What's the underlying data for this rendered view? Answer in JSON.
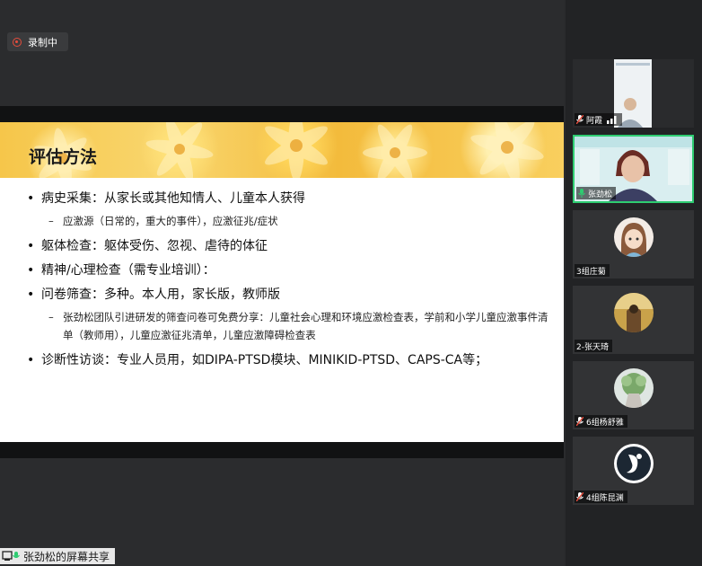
{
  "recording": {
    "label": "录制中"
  },
  "slide": {
    "title": "评估方法",
    "bullets": [
      {
        "text": "病史采集：从家长或其他知情人、儿童本人获得"
      },
      {
        "sub": "应激源（日常的，重大的事件），应激征兆/症状"
      },
      {
        "text": "躯体检查：躯体受伤、忽视、虐待的体征"
      },
      {
        "text": "精神/心理检查（需专业培训）："
      },
      {
        "text": "问卷筛查：多种。本人用，家长版，教师版"
      },
      {
        "sub": "张劲松团队引进研发的筛查问卷可免费分享：儿童社会心理和环境应激检查表，学前和小学儿童应激事件清单（教师用），儿童应激征兆清单，儿童应激障碍检查表"
      },
      {
        "text": "诊断性访谈：专业人员用，如DIPA-PTSD模块、MINIKID-PTSD、CAPS-CA等；"
      }
    ],
    "dash": "–"
  },
  "share": {
    "label": "张劲松的屏幕共享"
  },
  "participants": [
    {
      "name": "阿霞",
      "muted": true,
      "speaking": false
    },
    {
      "name": "张劲松",
      "muted": false,
      "speaking": true
    },
    {
      "name": "3组庄菊",
      "muted": false,
      "speaking": false
    },
    {
      "name": "2-张天琦",
      "muted": false,
      "speaking": false
    },
    {
      "name": "6组杨舒雅",
      "muted": true,
      "speaking": false
    },
    {
      "name": "4组陈昆渊",
      "muted": true,
      "speaking": false
    }
  ],
  "colors": {
    "active_border": "#2ecc71",
    "mic_on": "#2ecc71",
    "mic_muted": "#e74c3c",
    "record": "#e74c3c"
  }
}
